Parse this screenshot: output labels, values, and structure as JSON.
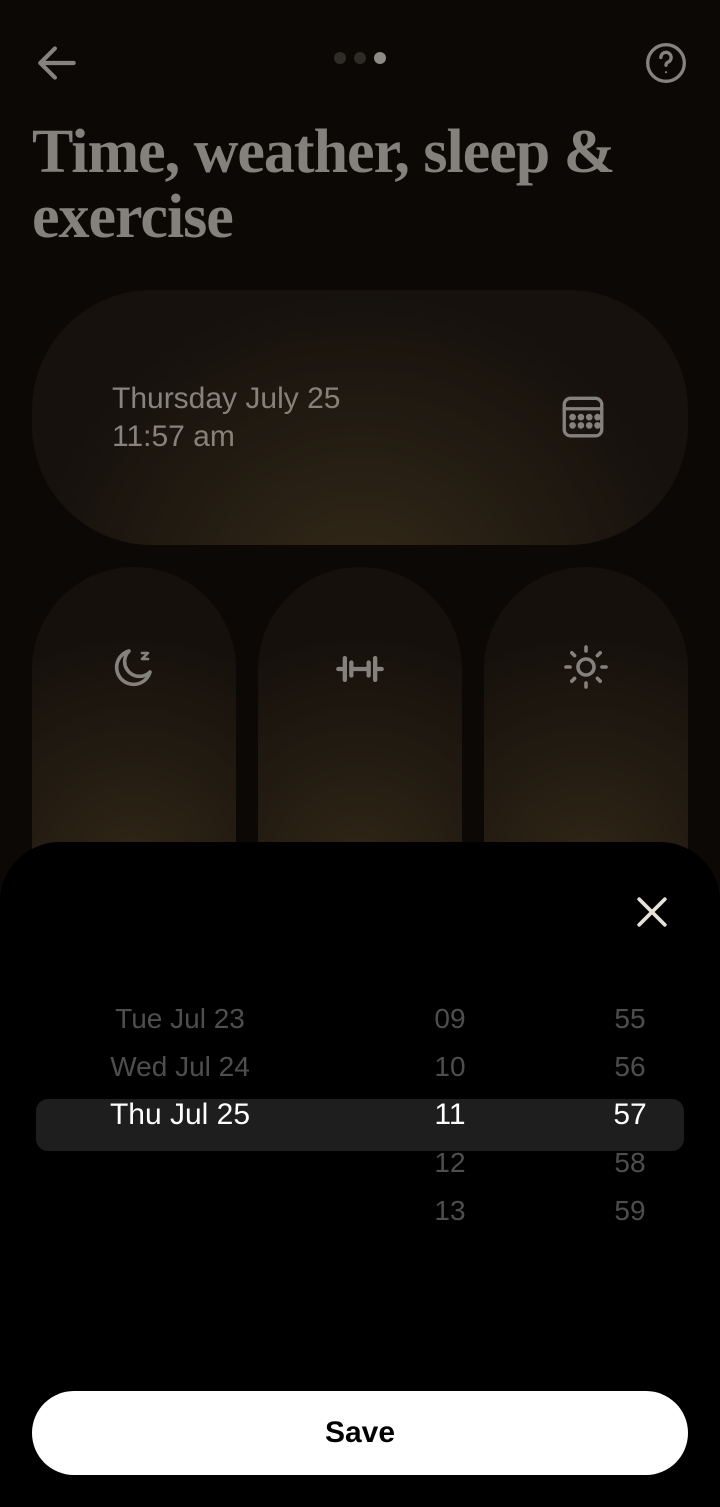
{
  "progress": {
    "total": 3,
    "current": 3
  },
  "title": "Time, weather, sleep & exercise",
  "date_card": {
    "date_line": "Thursday July 25",
    "time_line": "11:57 am"
  },
  "tiles": {
    "sleep_icon": "moon-sleep",
    "exercise_icon": "dumbbell",
    "weather_icon": "sun"
  },
  "picker": {
    "dates": [
      "Tue Jul 23",
      "Wed Jul 24",
      "Thu Jul 25",
      "",
      ""
    ],
    "date_selected_index": 2,
    "hours": [
      "09",
      "10",
      "11",
      "12",
      "13"
    ],
    "hour_selected_index": 2,
    "minutes": [
      "55",
      "56",
      "57",
      "58",
      "59"
    ],
    "minute_selected_index": 2
  },
  "save_label": "Save"
}
